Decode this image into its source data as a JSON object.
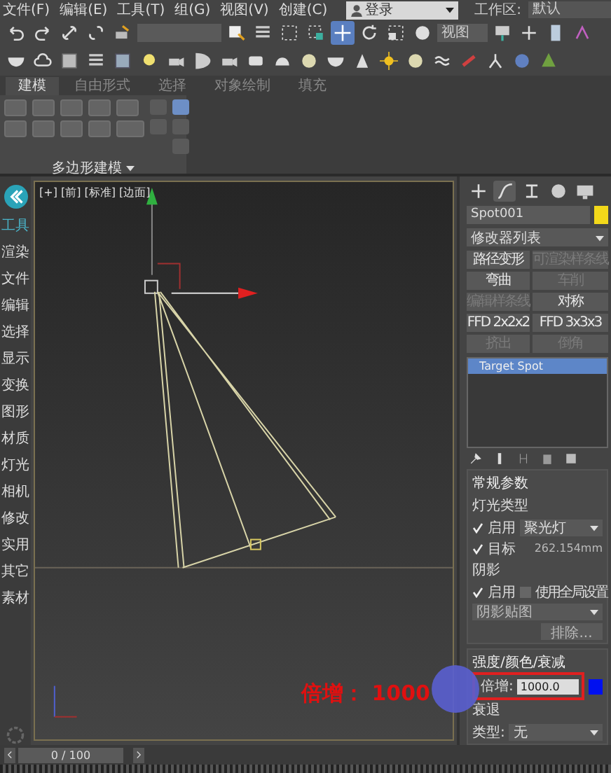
{
  "menu_bar": {
    "items": [
      "文件(F)",
      "编辑(E)",
      "工具(T)",
      "组(G)",
      "视图(V)",
      "创建(C)"
    ],
    "login": "登录",
    "workspace_label": "工作区:",
    "workspace": "默认"
  },
  "main_toolbar": {
    "tools": [
      {
        "kind": "undo",
        "selected": false
      },
      {
        "kind": "redo",
        "selected": false
      },
      {
        "kind": "link",
        "selected": false
      },
      {
        "kind": "unlink",
        "selected": false
      },
      {
        "kind": "bind",
        "selected": false
      },
      {
        "kind": "filter",
        "selected": false
      },
      {
        "kind": "select",
        "selected": false
      },
      {
        "kind": "list",
        "selected": false
      },
      {
        "kind": "region",
        "selected": false
      },
      {
        "kind": "window",
        "selected": false
      },
      {
        "kind": "move",
        "selected": true
      },
      {
        "kind": "rotate",
        "selected": false
      },
      {
        "kind": "scale",
        "selected": false
      },
      {
        "kind": "place",
        "selected": false
      },
      {
        "kind": "coord",
        "selected": false
      },
      {
        "kind": "pivot",
        "selected": false
      },
      {
        "kind": "cross",
        "selected": false
      },
      {
        "kind": "key",
        "selected": false
      },
      {
        "kind": "snap",
        "selected": false
      }
    ],
    "coord_system": "视图"
  },
  "object_toolbar": {
    "tools": [
      {
        "kind": "teapot"
      },
      {
        "kind": "cloud"
      },
      {
        "kind": "frame"
      },
      {
        "kind": "list"
      },
      {
        "kind": "grid"
      },
      {
        "kind": "bulb"
      },
      {
        "kind": "camera"
      },
      {
        "kind": "halfmoon"
      },
      {
        "kind": "camera"
      },
      {
        "kind": "box"
      },
      {
        "kind": "dome"
      },
      {
        "kind": "sphere"
      },
      {
        "kind": "teapot"
      },
      {
        "kind": "cone"
      },
      {
        "kind": "sun"
      },
      {
        "kind": "sphere"
      },
      {
        "kind": "waves"
      },
      {
        "kind": "bones"
      },
      {
        "kind": "robot"
      },
      {
        "kind": "globe"
      },
      {
        "kind": "tree"
      }
    ]
  },
  "ribbon": {
    "tabs": [
      {
        "label": "建模",
        "selected": true
      },
      {
        "label": "自由形式",
        "selected": false
      },
      {
        "label": "选择",
        "selected": false
      },
      {
        "label": "对象绘制",
        "selected": false
      },
      {
        "label": "填充",
        "selected": false
      }
    ],
    "panel_label": "多边形建模"
  },
  "sidebar": {
    "items": [
      {
        "label": "工具",
        "selected": true
      },
      {
        "label": "渲染",
        "selected": false
      },
      {
        "label": "文件",
        "selected": false
      },
      {
        "label": "编辑",
        "selected": false
      },
      {
        "label": "选择",
        "selected": false
      },
      {
        "label": "显示",
        "selected": false
      },
      {
        "label": "变换",
        "selected": false
      },
      {
        "label": "图形",
        "selected": false
      },
      {
        "label": "材质",
        "selected": false
      },
      {
        "label": "灯光",
        "selected": false
      },
      {
        "label": "相机",
        "selected": false
      },
      {
        "label": "修改",
        "selected": false
      },
      {
        "label": "实用",
        "selected": false
      },
      {
        "label": "其它",
        "selected": false
      },
      {
        "label": "素材",
        "selected": false
      }
    ]
  },
  "viewport": {
    "label": "[+] [前] [标准] [边面]",
    "annotation": "倍增： 1000"
  },
  "command_panel": {
    "tabs": [
      {
        "kind": "create",
        "selected": false
      },
      {
        "kind": "modify",
        "selected": true
      },
      {
        "kind": "hierarchy",
        "selected": false
      },
      {
        "kind": "motion",
        "selected": false
      },
      {
        "kind": "display",
        "selected": false
      }
    ],
    "object_name": "Spot001",
    "modifier_list": "修改器列表",
    "modifier_buttons": [
      {
        "label": "路径变形",
        "disabled": false
      },
      {
        "label": "可渲染样条线",
        "disabled": true
      },
      {
        "label": "弯曲",
        "disabled": false
      },
      {
        "label": "车削",
        "disabled": true
      },
      {
        "label": "编辑样条线",
        "disabled": true
      },
      {
        "label": "对称",
        "disabled": false
      },
      {
        "label": "FFD 2x2x2",
        "disabled": false
      },
      {
        "label": "FFD 3x3x3",
        "disabled": false
      },
      {
        "label": "挤出",
        "disabled": true
      },
      {
        "label": "倒角",
        "disabled": true
      }
    ],
    "stack": [
      {
        "label": "Target Spot",
        "selected": true
      }
    ],
    "general": {
      "title": "常规参数",
      "light_type": "灯光类型",
      "on_label": "启用",
      "on_checked": true,
      "light_kind": "聚光灯",
      "targeted_label": "目标",
      "targeted_checked": true,
      "target_distance": "262.154mm",
      "shadows": "阴影",
      "shadow_on_label": "启用",
      "shadow_on": true,
      "global_label": "使用全局设置",
      "global_checked": false,
      "shadow_type": "阴影贴图",
      "exclude": "排除..."
    },
    "intensity": {
      "title": "强度/颜色/衰减",
      "multiplier_label": "倍增:",
      "multiplier": "1000.0",
      "decay_title": "衰退",
      "decay_type_label": "类型:",
      "decay_type": "无"
    }
  },
  "timeline": {
    "position": "0 / 100",
    "level": 0
  }
}
